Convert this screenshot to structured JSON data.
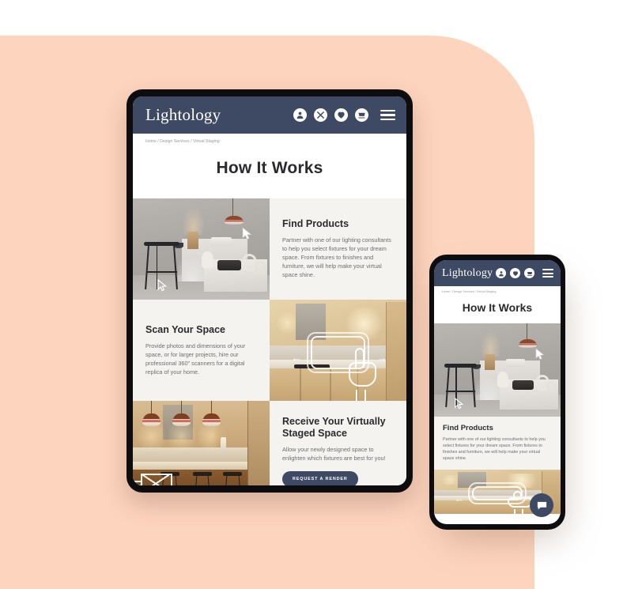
{
  "theme": {
    "page_background": "#ffffff",
    "backdrop_shape_color": "#fdd4be",
    "navy": "#3e4963",
    "panel_background": "#f5f3f0",
    "heading_color": "#2b2b2e",
    "body_text_color": "#6e6e72",
    "device_frame_color": "#0d0d0f"
  },
  "tablet": {
    "brand": "Lightology",
    "nav_icons": [
      {
        "name": "account-icon",
        "glyph": "person"
      },
      {
        "name": "tools-icon",
        "glyph": "tools"
      },
      {
        "name": "wishlist-heart-icon",
        "glyph": "heart"
      },
      {
        "name": "shopping-cart-icon",
        "glyph": "cart"
      }
    ],
    "menu_icon": "hamburger-menu-icon",
    "breadcrumb": "Home / Design Services / Virtual Staging",
    "page_title": "How It Works",
    "sections": [
      {
        "title": "Find Products",
        "body": "Partner with one of our lighting consultants to help you select fixtures for your dream space. From fixtures to finishes and furniture, we will help make your virtual space shine.",
        "image_alt": "grey-showroom-with-stool-and-pendant-lamp",
        "image_side": "left",
        "button": null
      },
      {
        "title": "Scan Your Space",
        "body": "Provide photos and dimensions of your space, or for larger projects, hire our professional 360\" scanners for a digital replica of your home.",
        "image_alt": "warm-kitchen-with-scanning-frame-and-hand",
        "image_side": "right",
        "button": null
      },
      {
        "title": "Receive Your Virtually Staged Space",
        "body": "Allow your newly designed space to enlighten which fixtures are best for you!",
        "image_alt": "staged-kitchen-with-three-pendant-lights",
        "image_side": "left",
        "button": "REQUEST A RENDER"
      }
    ]
  },
  "phone": {
    "brand": "Lightology",
    "nav_icons": [
      {
        "name": "account-icon",
        "glyph": "person"
      },
      {
        "name": "wishlist-heart-icon",
        "glyph": "heart"
      },
      {
        "name": "shopping-cart-icon",
        "glyph": "cart"
      }
    ],
    "menu_icon": "hamburger-menu-icon",
    "breadcrumb": "Home / Design Services / Virtual Staging",
    "page_title": "How It Works",
    "sections": [
      {
        "title": "Find Products",
        "body": "Partner with one of our lighting consultants to help you select fixtures for your dream space. From fixtures to finishes and furniture, we will help make your virtual space shine.",
        "image_alt": "grey-showroom-with-stool-and-pendant-lamp"
      }
    ],
    "secondary_image_alt": "warm-kitchen-with-scanning-frame-and-hand",
    "chat_button_icon": "chat-bubble-icon"
  }
}
